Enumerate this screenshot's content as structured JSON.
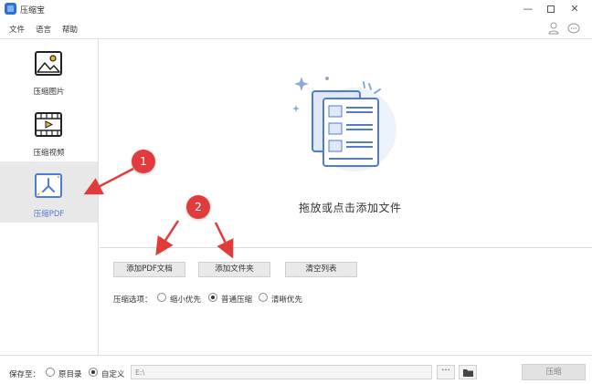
{
  "window": {
    "title": "压缩宝",
    "minimize": "—",
    "close": "✕"
  },
  "menu": {
    "file": "文件",
    "language": "语言",
    "help": "帮助"
  },
  "sidebar": {
    "items": [
      {
        "label": "压缩图片",
        "icon": "image-icon",
        "selected": false
      },
      {
        "label": "压缩视频",
        "icon": "video-icon",
        "selected": false
      },
      {
        "label": "压缩PDF",
        "icon": "pdf-icon",
        "selected": true
      }
    ]
  },
  "dropzone": {
    "text": "拖放或点击添加文件",
    "icon": "pdf-documents-icon"
  },
  "buttons": {
    "add_pdf": "添加PDF文档",
    "add_folder": "添加文件夹",
    "clear_list": "清空列表"
  },
  "compress_options": {
    "label": "压缩选项：",
    "options": [
      "缩小优先",
      "普通压缩",
      "清晰优先"
    ],
    "selected": "普通压缩"
  },
  "save": {
    "label": "保存至：",
    "options": [
      "原目录",
      "自定义"
    ],
    "selected": "自定义",
    "path": "E:\\",
    "browse_label": "···",
    "compress_button": "压缩"
  },
  "annotations": {
    "badge_1": "1",
    "badge_2": "2"
  },
  "colors": {
    "accent": "#4f7bd6",
    "badge": "#e23b3b",
    "selected_bg": "#e8e8e8"
  }
}
